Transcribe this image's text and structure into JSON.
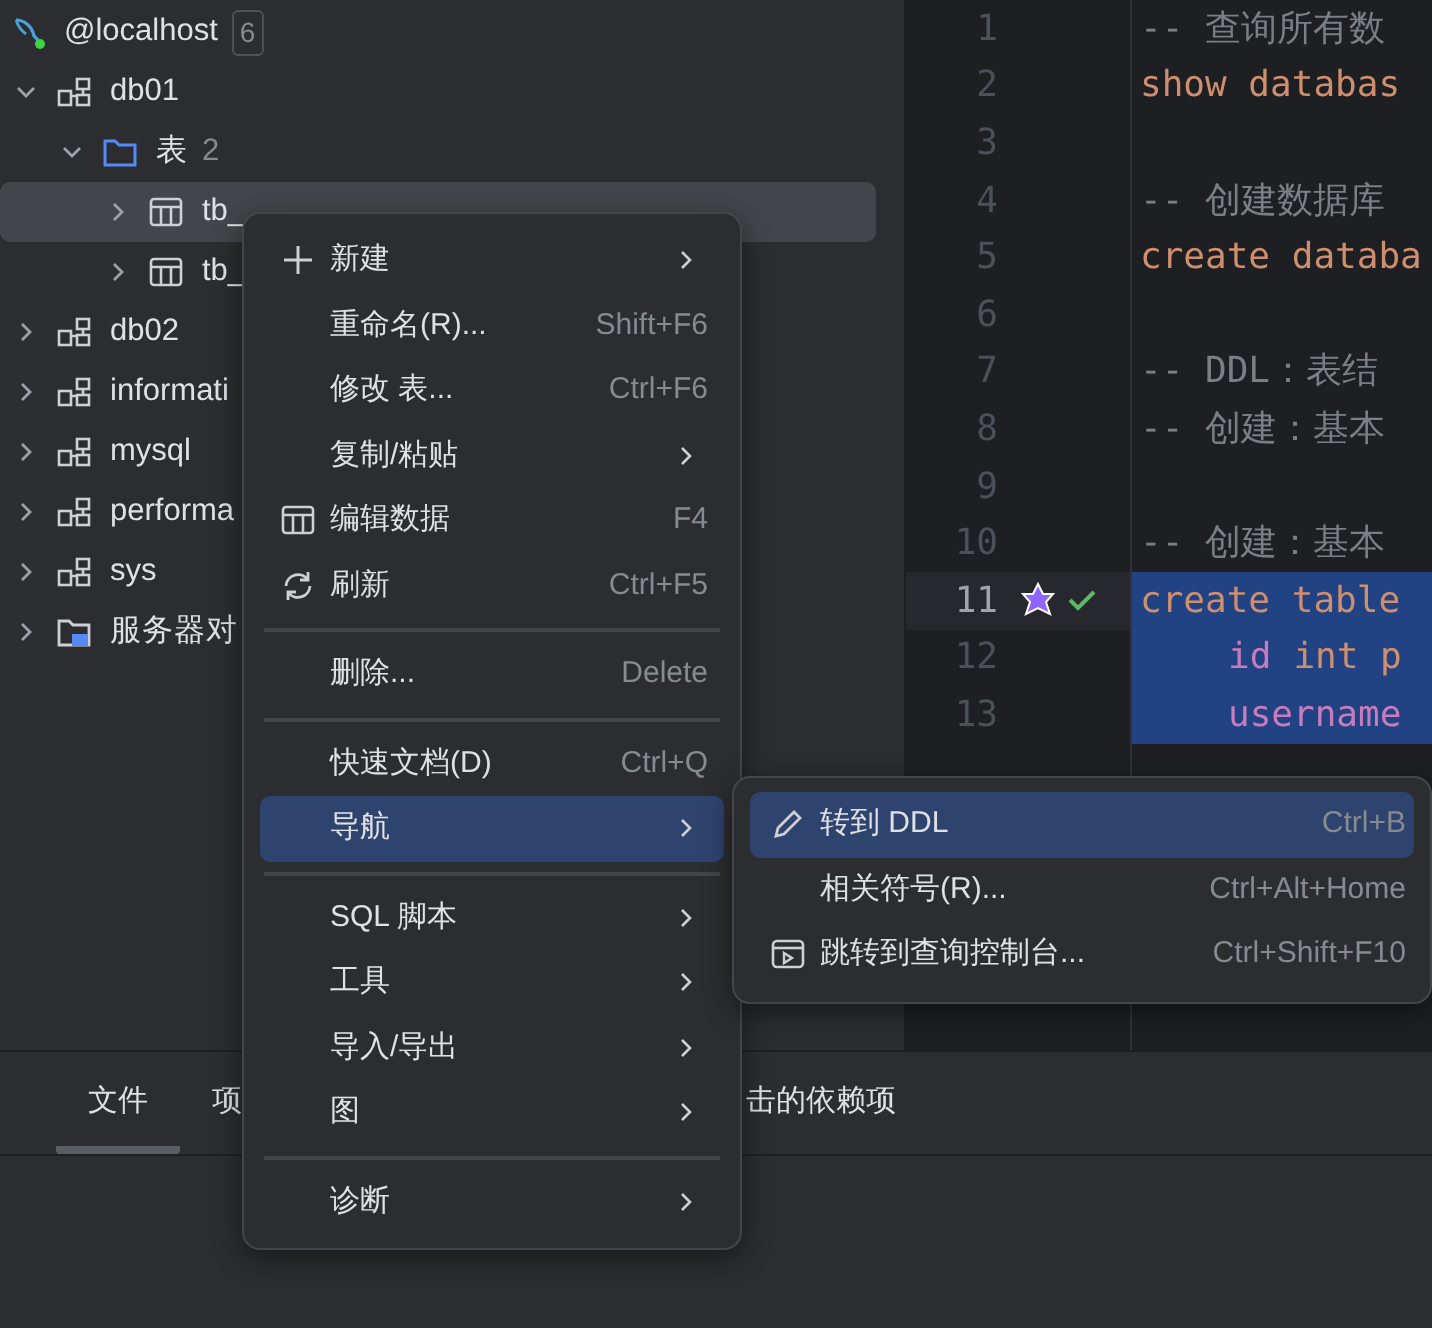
{
  "tree": [
    {
      "kind": "server",
      "label": "@localhost",
      "count": "6",
      "selected": false,
      "children": [
        {
          "kind": "schema",
          "label": "db01",
          "expanded": true,
          "selected": false,
          "children": [
            {
              "kind": "folder",
              "label": "表",
              "count": "2",
              "expanded": true,
              "selected": false,
              "children": [
                {
                  "kind": "table",
                  "label": "tb_",
                  "expanded": false,
                  "selected": true
                },
                {
                  "kind": "table",
                  "label": "tb_",
                  "expanded": false,
                  "selected": false
                }
              ]
            }
          ]
        },
        {
          "kind": "schema",
          "label": "db02",
          "expanded": false,
          "selected": false
        },
        {
          "kind": "schema",
          "label": "informati",
          "expanded": false,
          "selected": false
        },
        {
          "kind": "schema",
          "label": "mysql",
          "expanded": false,
          "selected": false
        },
        {
          "kind": "schema",
          "label": "performa",
          "expanded": false,
          "selected": false
        },
        {
          "kind": "schema",
          "label": "sys",
          "expanded": false,
          "selected": false
        },
        {
          "kind": "server_objects",
          "label": "服务器对",
          "expanded": false,
          "selected": false
        }
      ]
    }
  ],
  "editor": {
    "lines": [
      {
        "number": "1",
        "tokens": [
          {
            "kind": "comment",
            "text": "-- 查询所有数"
          }
        ]
      },
      {
        "number": "2",
        "tokens": [
          {
            "kind": "keyword",
            "text": "show databas"
          }
        ]
      },
      {
        "number": "3"
      },
      {
        "number": "4",
        "tokens": [
          {
            "kind": "comment",
            "text": "-- 创建数据库"
          }
        ]
      },
      {
        "number": "5",
        "tokens": [
          {
            "kind": "keyword",
            "text": "create databa"
          }
        ]
      },
      {
        "number": "6"
      },
      {
        "number": "7",
        "tokens": [
          {
            "kind": "comment",
            "text": "-- DDL：表结"
          }
        ]
      },
      {
        "number": "8",
        "tokens": [
          {
            "kind": "comment",
            "text": "-- 创建：基本"
          }
        ]
      },
      {
        "number": "9"
      },
      {
        "number": "10",
        "tokens": [
          {
            "kind": "comment",
            "text": "-- 创建：基本"
          }
        ]
      },
      {
        "number": "11",
        "current": true,
        "selected": true,
        "run_marker": true,
        "tokens": [
          {
            "kind": "keyword",
            "text": "create table"
          }
        ]
      },
      {
        "number": "12",
        "selected": true,
        "indented": true,
        "tokens": [
          {
            "kind": "field",
            "text": "id"
          },
          {
            "kind": "keyword",
            "text": "int p"
          }
        ]
      },
      {
        "number": "13",
        "selected": true,
        "indented": true,
        "tokens": [
          {
            "kind": "field",
            "text": "username"
          }
        ]
      }
    ]
  },
  "bottom_tabs": [
    {
      "label": "文件",
      "selected": true
    },
    {
      "label": "项",
      "selected": false
    },
    {
      "label": "击的依赖项",
      "selected": false
    }
  ],
  "context_menu": {
    "groups": [
      [
        {
          "label": "新建",
          "submenu": true,
          "selected": false
        },
        {
          "label": "重命名(R)...",
          "shortcut": "Shift+F6",
          "selected": false
        },
        {
          "label": "修改 表...",
          "shortcut": "Ctrl+F6",
          "selected": false
        },
        {
          "label": "复制/粘贴",
          "submenu": true,
          "selected": false
        },
        {
          "label": "编辑数据",
          "shortcut": "F4",
          "selected": false
        },
        {
          "label": "刷新",
          "shortcut": "Ctrl+F5",
          "selected": false
        }
      ],
      [
        {
          "label": "删除...",
          "shortcut": "Delete",
          "selected": false
        }
      ],
      [
        {
          "label": "快速文档(D)",
          "shortcut": "Ctrl+Q",
          "selected": false
        },
        {
          "label": "导航",
          "submenu": true,
          "selected": true
        }
      ],
      [
        {
          "label": "SQL 脚本",
          "submenu": true,
          "selected": false
        },
        {
          "label": "工具",
          "submenu": true,
          "selected": false
        },
        {
          "label": "导入/导出",
          "submenu": true,
          "selected": false
        },
        {
          "label": "图",
          "submenu": true,
          "selected": false
        }
      ],
      [
        {
          "label": "诊断",
          "submenu": true,
          "selected": false
        }
      ]
    ]
  },
  "submenu": {
    "items": [
      {
        "label": "转到 DDL",
        "shortcut": "Ctrl+B",
        "selected": true
      },
      {
        "label": "相关符号(R)...",
        "shortcut": "Ctrl+Alt+Home",
        "selected": false
      },
      {
        "label": "跳转到查询控制台...",
        "shortcut": "Ctrl+Shift+F10",
        "selected": false
      }
    ]
  }
}
